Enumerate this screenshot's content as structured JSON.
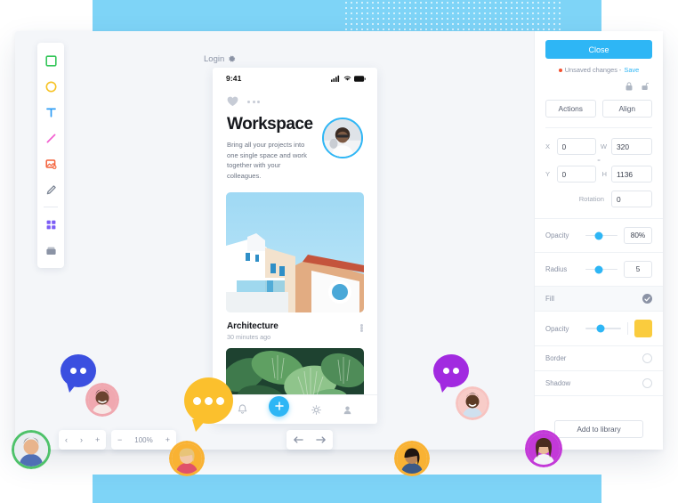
{
  "app": {
    "artboard_label": "Login",
    "artboard_settings_icon": "gear-icon"
  },
  "toolbar": {
    "items": [
      {
        "name": "rectangle-tool",
        "icon": "square-icon",
        "color": "#35c65a"
      },
      {
        "name": "ellipse-tool",
        "icon": "circle-icon",
        "color": "#f7c325"
      },
      {
        "name": "text-tool",
        "icon": "text-t-icon",
        "color": "#2e9df5"
      },
      {
        "name": "line-tool",
        "icon": "line-icon",
        "color": "#f25fd0"
      },
      {
        "name": "image-tool",
        "icon": "image-plus-icon",
        "color": "#f4613a"
      },
      {
        "name": "pen-tool",
        "icon": "pen-icon",
        "color": "#7b8494"
      },
      {
        "name": "components-tool",
        "icon": "grid-icon",
        "color": "#7b5cf5"
      },
      {
        "name": "archive-tool",
        "icon": "archive-icon",
        "color": "#8b93a5"
      }
    ]
  },
  "phone": {
    "status": {
      "time": "9:41",
      "icons": [
        "signal-icon",
        "wifi-icon",
        "battery-icon"
      ]
    },
    "top_icons": [
      "heart-icon",
      "more-dots-icon"
    ],
    "hero": {
      "title": "Workspace",
      "description": "Bring all your projects into one single space and work together with your colleagues.",
      "avatar": "hero-avatar"
    },
    "card": {
      "title": "Architecture",
      "timestamp": "30 minutes ago",
      "more_icon": "more-dots-icon"
    },
    "tabbar": {
      "items": [
        {
          "name": "tab-notifications",
          "icon": "bell-icon"
        },
        {
          "name": "tab-add",
          "icon": "plus-icon"
        },
        {
          "name": "tab-settings",
          "icon": "gear-icon"
        },
        {
          "name": "tab-profile",
          "icon": "person-icon"
        }
      ]
    }
  },
  "inspector": {
    "close_label": "Close",
    "unsaved_text": "Unsaved changes -",
    "save_label": "Save",
    "lock_icons": [
      "lock-closed-icon",
      "lock-open-icon"
    ],
    "actions_label": "Actions",
    "align_label": "Align",
    "fields": {
      "x_label": "X",
      "x_value": "0",
      "y_label": "Y",
      "y_value": "0",
      "w_label": "W",
      "w_value": "320",
      "h_label": "H",
      "h_value": "1136",
      "link_icon": "link-chain-icon",
      "rotation_label": "Rotation",
      "rotation_value": "0"
    },
    "opacity_label": "Opacity",
    "opacity_value": "80%",
    "radius_label": "Radius",
    "radius_value": "5",
    "fill_label": "Fill",
    "fill_enabled": true,
    "fill_opacity_label": "Opacity",
    "fill_color": "#facc3e",
    "border_label": "Border",
    "border_enabled": false,
    "shadow_label": "Shadow",
    "shadow_enabled": false,
    "add_to_library_label": "Add to library"
  },
  "controls": {
    "pager": {
      "prev_icon": "chevron-left-icon",
      "next_icon": "chevron-right-icon",
      "add_icon": "plus-icon"
    },
    "zoom": {
      "minus_icon": "minus-icon",
      "level": "100%",
      "plus_icon": "plus-icon"
    },
    "history": {
      "undo_icon": "undo-arrow-icon",
      "redo_icon": "redo-arrow-icon"
    }
  },
  "collaborators": {
    "bubbles": [
      {
        "name": "chat-bubble-blue",
        "color": "#3b4fe0",
        "dots": 2
      },
      {
        "name": "chat-bubble-yellow",
        "color": "#fbc02d",
        "dots": 3
      },
      {
        "name": "chat-bubble-purple",
        "color": "#a12ae0",
        "dots": 2
      }
    ],
    "avatars": [
      {
        "name": "avatar-green",
        "ring": "#4ec26a"
      },
      {
        "name": "avatar-pink-left",
        "ring": "#f0a8b0"
      },
      {
        "name": "avatar-orange-blonde",
        "ring": "#f9b233"
      },
      {
        "name": "avatar-orange-dark",
        "ring": "#f9b233"
      },
      {
        "name": "avatar-pink-right",
        "ring": "#f7c3c0"
      },
      {
        "name": "avatar-purple",
        "ring": "#c339d8"
      }
    ]
  },
  "theme": {
    "accent": "#2eb6f5",
    "band": "#7ed4f7",
    "canvas_bg": "#f4f6f9"
  }
}
